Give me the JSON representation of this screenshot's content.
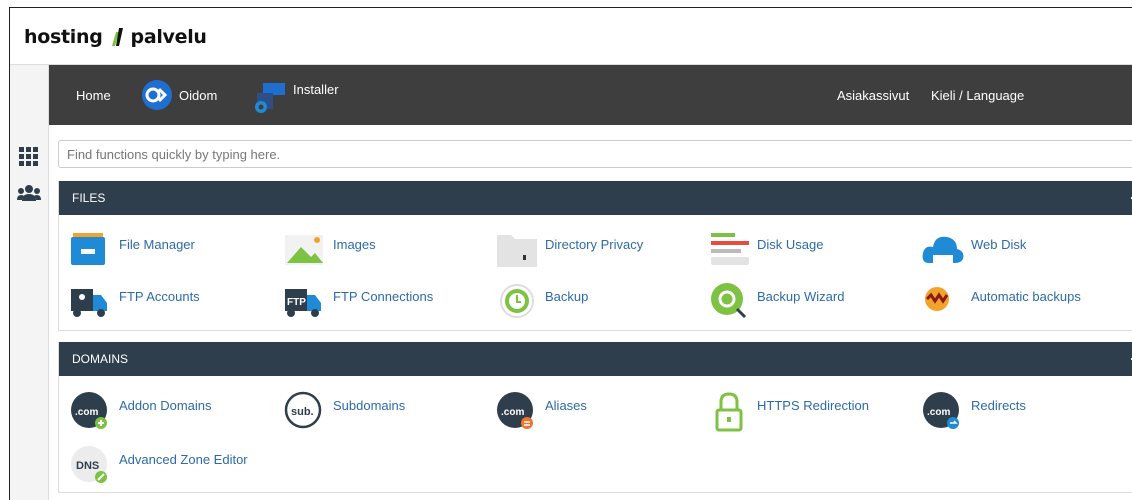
{
  "brand": {
    "text_left": "hosting",
    "text_right": "palvelu"
  },
  "topnav": {
    "home": "Home",
    "oidom": "Oidom",
    "installer": "Installer",
    "customer_pages": "Asiakassivut",
    "language": "Kieli / Language"
  },
  "search": {
    "placeholder": "Find functions quickly by typing here."
  },
  "files": {
    "title": "FILES",
    "items": [
      "File Manager",
      "Images",
      "Directory Privacy",
      "Disk Usage",
      "Web Disk",
      "FTP Accounts",
      "FTP Connections",
      "Backup",
      "Backup Wizard",
      "Automatic backups"
    ]
  },
  "domains": {
    "title": "DOMAINS",
    "items": [
      "Addon Domains",
      "Subdomains",
      "Aliases",
      "HTTPS Redirection",
      "Redirects",
      "Advanced Zone Editor"
    ],
    "icon_text": {
      "com": ".com",
      "sub": "sub.",
      "dns": "DNS"
    }
  },
  "colors": {
    "nav_bg": "#3e3e3e",
    "panel_head": "#2f3e4c",
    "link": "#2d6aa8",
    "accent_green": "#7dc242",
    "accent_blue": "#1f8ad6"
  }
}
